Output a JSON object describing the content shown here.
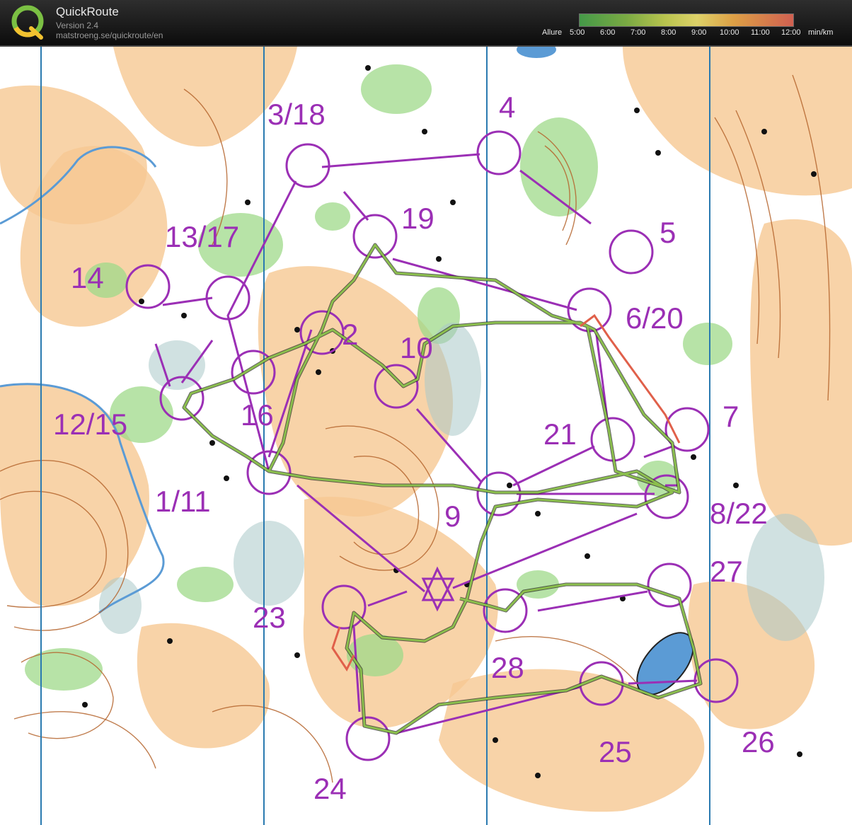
{
  "app": {
    "title": "QuickRoute",
    "version": "Version 2.4",
    "url": "matstroeng.se/quickroute/en"
  },
  "legend": {
    "label": "Allure",
    "ticks": [
      "5:00",
      "6:00",
      "7:00",
      "8:00",
      "9:00",
      "10:00",
      "11:00",
      "12:00"
    ],
    "unit": "min/km"
  },
  "map": {
    "controls": [
      {
        "label": "3/18"
      },
      {
        "label": "4"
      },
      {
        "label": "19"
      },
      {
        "label": "5"
      },
      {
        "label": "13/17"
      },
      {
        "label": "14"
      },
      {
        "label": "6/20"
      },
      {
        "label": "2"
      },
      {
        "label": "10"
      },
      {
        "label": "12/15"
      },
      {
        "label": "16"
      },
      {
        "label": "21"
      },
      {
        "label": "7"
      },
      {
        "label": "1/11"
      },
      {
        "label": "9"
      },
      {
        "label": "8/22"
      },
      {
        "label": "27"
      },
      {
        "label": "23"
      },
      {
        "label": "28"
      },
      {
        "label": "25"
      },
      {
        "label": "26"
      },
      {
        "label": "24"
      }
    ],
    "colors": {
      "course": "#9b2fb5",
      "open_land": "#f6c892",
      "forest_green": "#9fd98a",
      "contour": "#b5652e",
      "water": "#5b9bd5",
      "meridian": "#2a7ab0",
      "route": "#6b8e3a"
    }
  }
}
